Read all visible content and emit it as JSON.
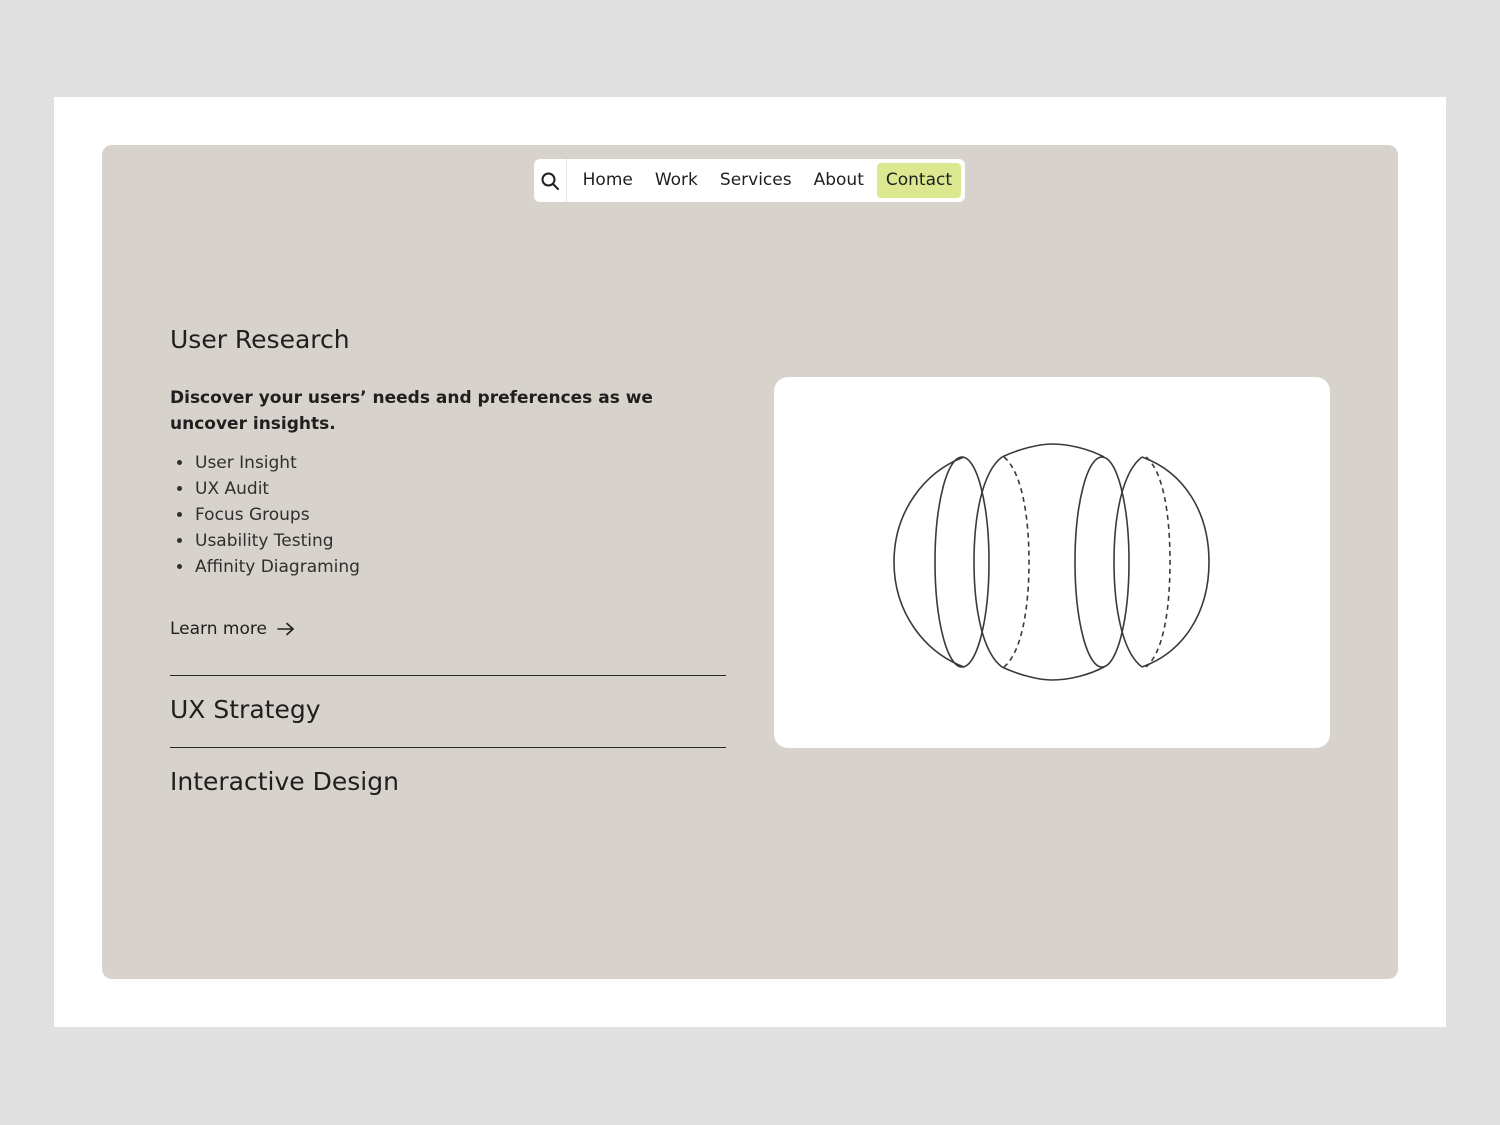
{
  "nav": {
    "search_icon": "search-icon",
    "links": [
      "Home",
      "Work",
      "Services",
      "About",
      "Contact"
    ],
    "active_highlight_color": "#dbe88f"
  },
  "service": {
    "title": "User Research",
    "description": "Discover your users’ needs and preferences as we uncover insights.",
    "items": [
      "User Insight",
      "UX Audit",
      "Focus Groups",
      "Usability Testing",
      "Affinity Diagraming"
    ],
    "learn_more": "Learn more",
    "learn_more_icon": "arrow-right-icon"
  },
  "accordion": [
    "UX Strategy",
    "Interactive Design"
  ],
  "colors": {
    "page_background": "#e0e0e0",
    "frame": "#ffffff",
    "panel": "#d7d2cb",
    "card": "#ffffff",
    "text": "#1f1f1f"
  },
  "illustration": "segmented-sphere-illustration"
}
